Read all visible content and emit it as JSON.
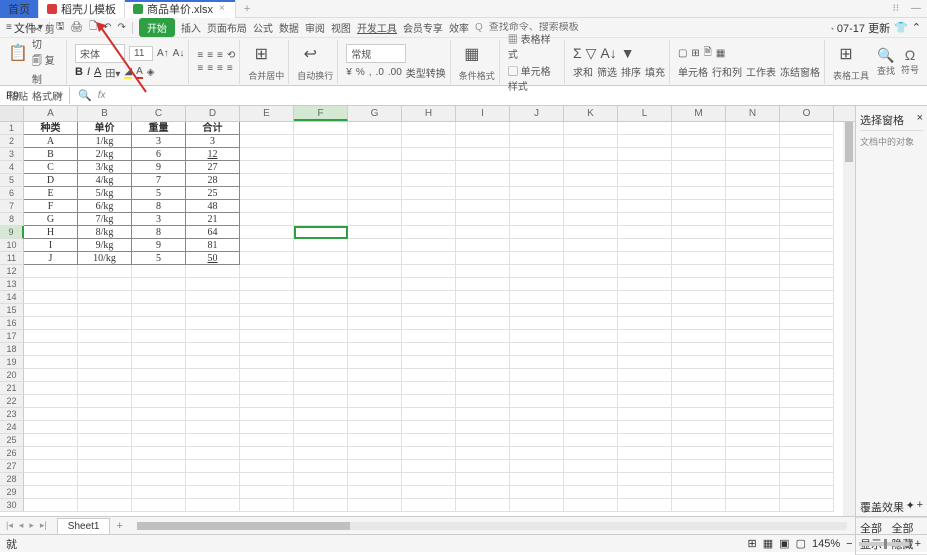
{
  "tabs": {
    "home": "首页",
    "red": "稻壳儿模板",
    "file": "商品单价.xlsx",
    "close": "×",
    "plus": "+"
  },
  "quick": {
    "menu": "文件",
    "file": "文件"
  },
  "update": {
    "text": "07-17 更新",
    "gear": "⚙"
  },
  "menu": {
    "start": "开始",
    "insert": "插入",
    "layout": "页面布局",
    "formula": "公式",
    "data": "数据",
    "review": "审阅",
    "view": "视图",
    "dev": "开发工具",
    "member": "会员专享",
    "efficiency": "效率"
  },
  "search": {
    "icon": "Q",
    "placeholder": "查找命令、搜索模板"
  },
  "ribbon": {
    "paste": "粘贴",
    "cut": "剪切",
    "copy": "复制",
    "format": "格式刷",
    "font": "宋体",
    "size": "11",
    "merge": "合并居中",
    "wrap": "自动换行",
    "general": "常规",
    "currency": "¥",
    "percent": "%",
    "comma": ",",
    "dec1": ".0",
    "dec2": ".00",
    "typeconv": "类型转换",
    "tableformat": "表格样式",
    "condformat": "条件格式",
    "cellformat": "单元格样式",
    "sum": "求和",
    "filter": "筛选",
    "sort": "排序",
    "fill": "填充",
    "cell": "单元格",
    "rowcol": "行和列",
    "sheet": "工作表",
    "freeze": "冻结窗格",
    "tools": "表格工具",
    "find": "查找",
    "symbol": "符号"
  },
  "namebox": "F9",
  "fx": "fx",
  "columns": [
    "A",
    "B",
    "C",
    "D",
    "E",
    "F",
    "G",
    "H",
    "I",
    "J",
    "K",
    "L",
    "M",
    "N",
    "O"
  ],
  "tablehdr": {
    "a": "种类",
    "b": "单价",
    "c": "重量",
    "d": "合计"
  },
  "data": [
    {
      "a": "A",
      "b": "1/kg",
      "c": "3",
      "d": "3"
    },
    {
      "a": "B",
      "b": "2/kg",
      "c": "6",
      "d": "12"
    },
    {
      "a": "C",
      "b": "3/kg",
      "c": "9",
      "d": "27"
    },
    {
      "a": "D",
      "b": "4/kg",
      "c": "7",
      "d": "28"
    },
    {
      "a": "E",
      "b": "5/kg",
      "c": "5",
      "d": "25"
    },
    {
      "a": "F",
      "b": "6/kg",
      "c": "8",
      "d": "48"
    },
    {
      "a": "G",
      "b": "7/kg",
      "c": "3",
      "d": "21"
    },
    {
      "a": "H",
      "b": "8/kg",
      "c": "8",
      "d": "64"
    },
    {
      "a": "I",
      "b": "9/kg",
      "c": "9",
      "d": "81"
    },
    {
      "a": "J",
      "b": "10/kg",
      "c": "5",
      "d": "50"
    }
  ],
  "rowcount": 30,
  "side": {
    "title": "选择窗格",
    "close": "×",
    "sub": "文档中的对象"
  },
  "sheet": {
    "name": "Sheet1",
    "plus": "+"
  },
  "footer": {
    "overlay": "覆盖效果",
    "tab": "✦",
    "plus": "+",
    "showall": "全部显示",
    "hideall": "全部隐藏"
  },
  "status": {
    "ready": "就",
    "zoom": "145%",
    "views": [
      "田",
      "▦",
      "▣",
      "▢"
    ]
  },
  "chart_data": {
    "type": "table",
    "columns": [
      "种类",
      "单价",
      "重量",
      "合计"
    ],
    "rows": [
      [
        "A",
        "1/kg",
        3,
        3
      ],
      [
        "B",
        "2/kg",
        6,
        12
      ],
      [
        "C",
        "3/kg",
        9,
        27
      ],
      [
        "D",
        "4/kg",
        7,
        28
      ],
      [
        "E",
        "5/kg",
        5,
        25
      ],
      [
        "F",
        "6/kg",
        8,
        48
      ],
      [
        "G",
        "7/kg",
        3,
        21
      ],
      [
        "H",
        "8/kg",
        8,
        64
      ],
      [
        "I",
        "9/kg",
        9,
        81
      ],
      [
        "J",
        "10/kg",
        5,
        50
      ]
    ]
  }
}
